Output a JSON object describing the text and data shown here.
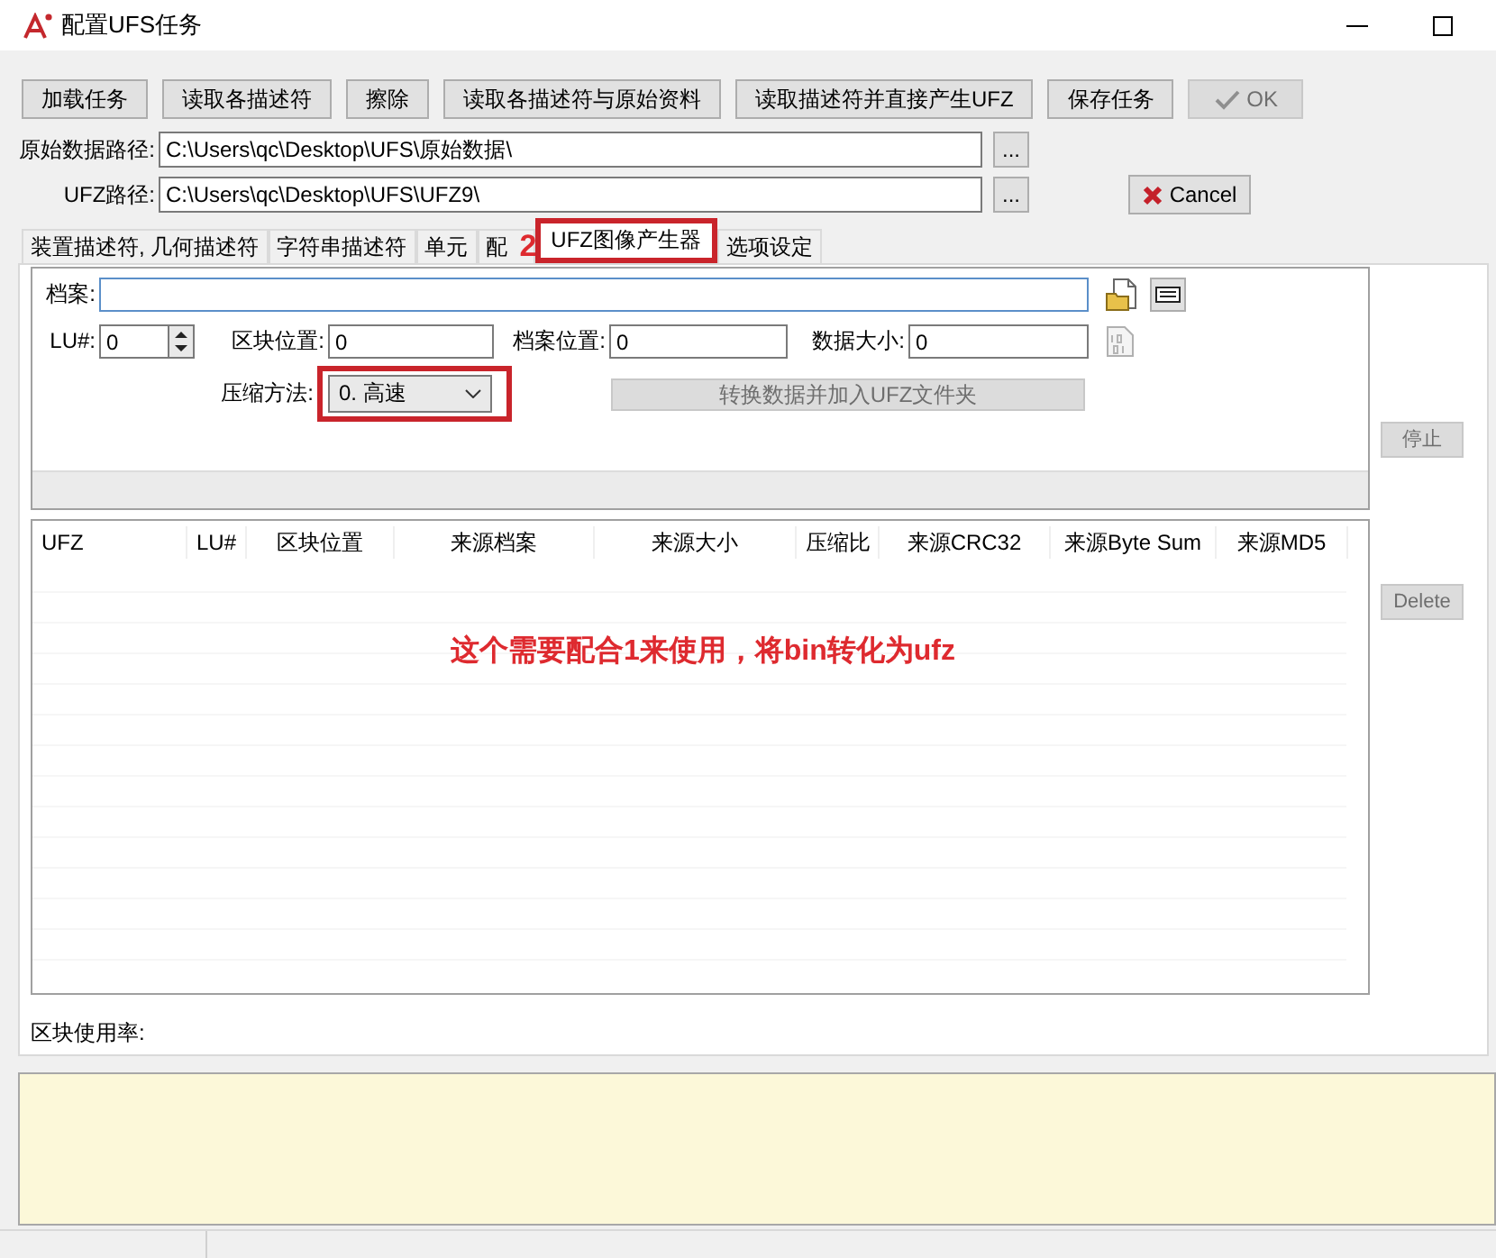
{
  "window": {
    "title": "配置UFS任务"
  },
  "toolbar": [
    {
      "label": "加载任务",
      "disabled": false,
      "kind": "text"
    },
    {
      "label": "读取各描述符",
      "disabled": false,
      "kind": "text"
    },
    {
      "label": "擦除",
      "disabled": false,
      "kind": "text"
    },
    {
      "label": "读取各描述符与原始资料",
      "disabled": false,
      "kind": "text"
    },
    {
      "label": "读取描述符并直接产生UFZ",
      "disabled": false,
      "kind": "text"
    },
    {
      "label": "保存任务",
      "disabled": false,
      "kind": "text"
    },
    {
      "label": "OK",
      "disabled": true,
      "kind": "ok"
    }
  ],
  "paths": [
    {
      "label": "原始数据路径:",
      "value": "C:\\Users\\qc\\Desktop\\UFS\\原始数据\\",
      "browse": "..."
    },
    {
      "label": "UFZ路径:",
      "value": "C:\\Users\\qc\\Desktop\\UFS\\UFZ9\\",
      "browse": "..."
    }
  ],
  "cancel_button": {
    "label": "Cancel"
  },
  "tabs": [
    {
      "label": "装置描述符, 几何描述符",
      "selected": false,
      "highlighted": false
    },
    {
      "label": "字符串描述符",
      "selected": false,
      "highlighted": false
    },
    {
      "label": "单元",
      "selected": false,
      "highlighted": false
    },
    {
      "label": "配",
      "selected": false,
      "highlighted": false
    },
    {
      "label": "UFZ图像产生器",
      "selected": true,
      "highlighted": true
    },
    {
      "label": "选项设定",
      "selected": false,
      "highlighted": false
    }
  ],
  "tab_page": {
    "file_label": "档案:",
    "lu": {
      "label": "LU#:",
      "value": "0"
    },
    "fields": [
      {
        "label": "区块位置:",
        "value": "0"
      },
      {
        "label": "档案位置:",
        "value": "0"
      },
      {
        "label": "数据大小:",
        "value": "0"
      }
    ],
    "compression": {
      "label": "压缩方法:",
      "value": "0. 高速",
      "highlighted": true
    },
    "convert_button": {
      "label": "转换数据并加入UFZ文件夹",
      "disabled": true
    }
  },
  "side_buttons": [
    {
      "label": "停止",
      "disabled": true
    },
    {
      "label": "Delete",
      "disabled": true
    }
  ],
  "table": {
    "columns": [
      "UFZ",
      "LU#",
      "区块位置",
      "来源档案",
      "来源大小",
      "压缩比",
      "来源CRC32",
      "来源Byte Sum",
      "来源MD5"
    ]
  },
  "usage_label": "区块使用率:",
  "annotations": [
    {
      "kind": "number",
      "text": "2"
    },
    {
      "kind": "note",
      "text": "这个需要配合1来使用，将bin转化为ufz"
    }
  ]
}
